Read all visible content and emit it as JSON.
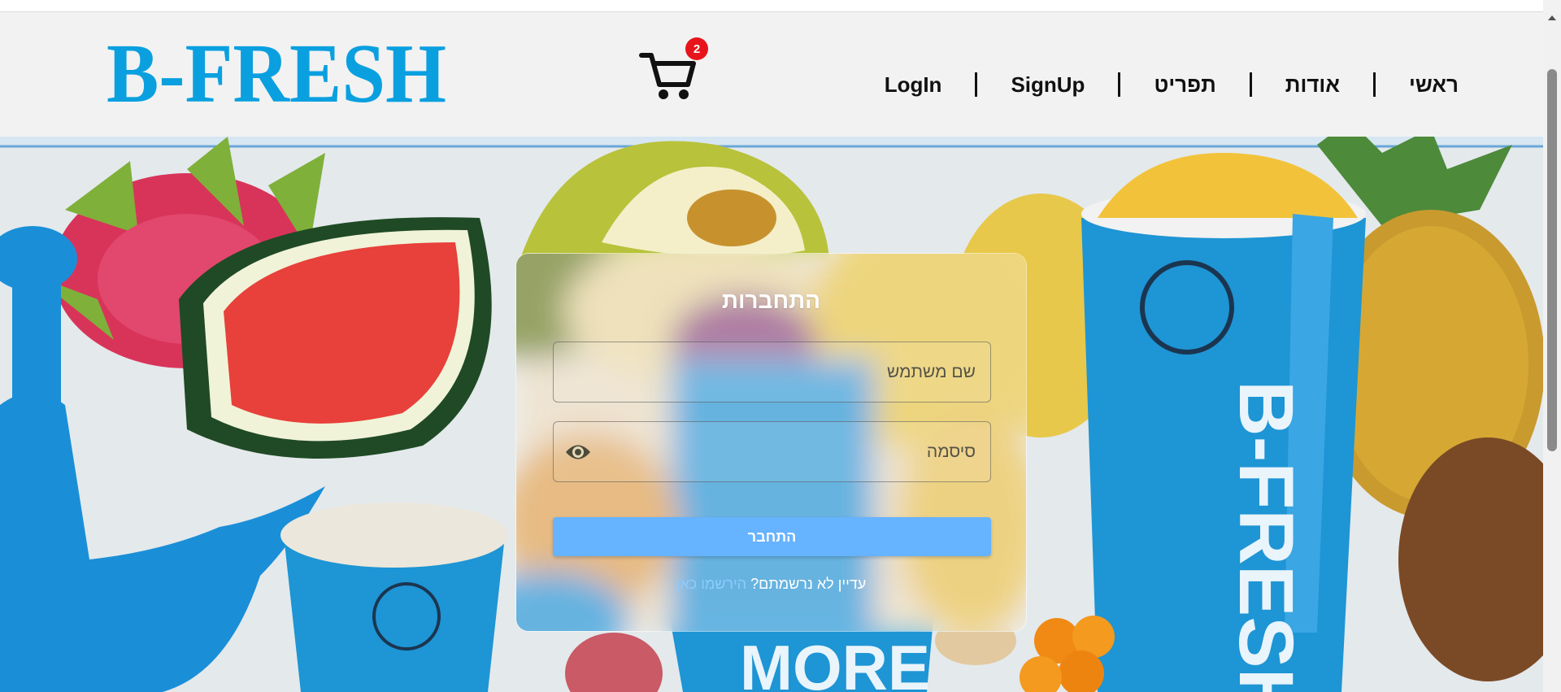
{
  "brand": {
    "logo_text": "B-FRESH",
    "color": "#0aa0e0"
  },
  "cart": {
    "icon": "cart-icon",
    "count": "2",
    "badge_color": "#e8141b"
  },
  "nav": {
    "items": [
      {
        "label": "ראשי"
      },
      {
        "label": "אודות"
      },
      {
        "label": "תפריט"
      },
      {
        "label": "SignUp"
      },
      {
        "label": "LogIn"
      }
    ]
  },
  "hero": {
    "cup_text": "MORE",
    "cup_brand": "B-FRESH"
  },
  "login": {
    "title": "התחברות",
    "username_placeholder": "שם משתמש",
    "password_placeholder": "סיסמה",
    "eye_icon": "eye-icon",
    "submit_label": "התחבר",
    "signup_prompt": "עדיין לא נרשמתם? ",
    "signup_link": "הירשמו כאן",
    "button_color": "#66b3ff"
  }
}
